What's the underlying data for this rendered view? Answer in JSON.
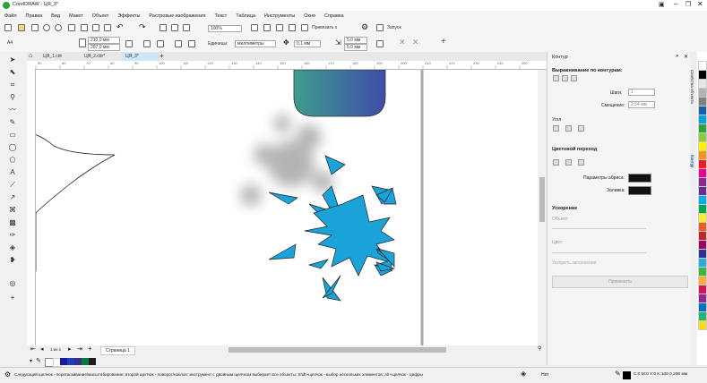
{
  "window": {
    "title": "CorelDRAW - ЦЯ_3*"
  },
  "menu": [
    "Файл",
    "Правка",
    "Вид",
    "Макет",
    "Объект",
    "Эффекты",
    "Растровые изображения",
    "Текст",
    "Таблица",
    "Инструменты",
    "Окно",
    "Справка"
  ],
  "toolbar1": {
    "zoom": "100%",
    "snap_label": "Привязать к",
    "launch_label": "Запуск"
  },
  "toolbar2": {
    "page_size": "A4",
    "width": "210,0 мм",
    "height": "297,0 мм",
    "units_label": "Единицы:",
    "units_value": "миллиметры",
    "nudge": "0,1 мм",
    "dup_x": "5,0 мм",
    "dup_y": "5,0 мм"
  },
  "doc_tabs": [
    "ЦЯ_1.cdr",
    "ЦЯ_2.cdr*",
    "ЦЯ_3*"
  ],
  "ruler_labels": [
    "50",
    "60",
    "70",
    "80",
    "90",
    "100",
    "110",
    "120",
    "130",
    "140",
    "150",
    "160",
    "170",
    "180",
    "190",
    "200",
    "210",
    "220",
    "230",
    "240",
    "250"
  ],
  "page_nav": {
    "current": "1 из 1",
    "page_tab": "Страница 1"
  },
  "docker": {
    "title": "Контур",
    "section_align": "Выравнивание по контурам:",
    "rows_label": "Шаги:",
    "rows_value": "1",
    "offset_label": "Смещение:",
    "offset_value": "2,54 мм",
    "corners_label": "Угол",
    "section_color": "Цветовой переход",
    "outline_color_label": "Параметры абриса:",
    "fill_label": "Заливка:",
    "section_accel": "Ускорение",
    "objects_label": "Объект:",
    "color_label": "Цвет:",
    "accel_check": "Ускорить заполнение",
    "apply_button": "Применить",
    "side_tab_1": "Свойства объекта",
    "side_tab_2": "Контур"
  },
  "status": {
    "hint": "Следующий щелчок - перетаскивание/масштабирование; второй щелчок - поворот/наклон; инструмент с двойным щелчком выбирает все объекты; Shift+щелчок - выбор нескольких элементов; Alt+щелчок - цифры",
    "fill_none": "Нет",
    "color_info": "C:0 M:0 Y:0 K:100  0,200 мм"
  },
  "colors": {
    "snowflake": "#1aa3d9",
    "gradient_start": "#3e9c8f",
    "gradient_end": "#3f4ea8",
    "accent_tab": "#cfe6f7"
  },
  "palette": [
    "#ffffff",
    "#000000",
    "#1b1b9e",
    "#1f3fb8",
    "#3b2d8c",
    "#007a3d",
    "#1c1c1c"
  ],
  "color_strip": [
    "#ffffff",
    "#000000",
    "#e6e6e6",
    "#b3b3b3",
    "#808080",
    "#1b5faa",
    "#00a0e3",
    "#2ea043",
    "#8dc63f",
    "#fff200",
    "#f7941d",
    "#ed1c24",
    "#ec008c",
    "#92278f",
    "#662d91",
    "#00aeef",
    "#00a651",
    "#f9ed32",
    "#f15a24",
    "#c1272d",
    "#9e005d",
    "#2e3192",
    "#29abe2",
    "#39b54a",
    "#fbb03b",
    "#d4145a",
    "#93278f",
    "#0071bc",
    "#22b573",
    "#ffde17"
  ]
}
